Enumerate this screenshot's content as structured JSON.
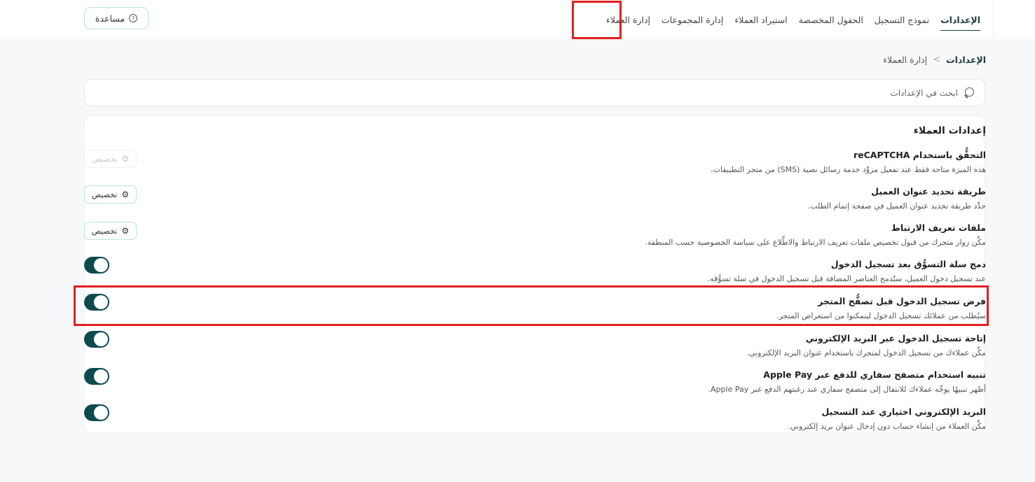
{
  "nav": {
    "items": [
      {
        "label": "إدارة العملاء",
        "active": false
      },
      {
        "label": "إدارة المجموعات",
        "active": false
      },
      {
        "label": "استيراد العملاء",
        "active": false
      },
      {
        "label": "الحقول المخصصة",
        "active": false
      },
      {
        "label": "نموذج التسجيل",
        "active": false
      },
      {
        "label": "الإعدادات",
        "active": true
      }
    ],
    "help_label": "مساعدة",
    "help_icon": "question-circle-icon"
  },
  "breadcrumb": {
    "parent": "إدارة العملاء",
    "separator": ">",
    "current": "الإعدادات"
  },
  "search": {
    "placeholder": "ابحث في الإعدادات",
    "value": ""
  },
  "section": {
    "title": "إعدادات العملاء"
  },
  "settings": [
    {
      "title": "التحقُّق باستخدام reCAPTCHA",
      "description": "هذه الميزة متاحة فقط عند تفعيل مزوِّد خدمة رسائل نصية (SMS) من متجر التطبيقات.",
      "control": "customize",
      "control_label": "تخصيص",
      "enabled": false
    },
    {
      "title": "طريقة تحديد عنوان العميل",
      "description": "حدِّد طريقة تحديد عنوان العميل في صفحة إتمام الطلب.",
      "control": "customize",
      "control_label": "تخصيص",
      "enabled": true
    },
    {
      "title": "ملفات تعريف الارتباط",
      "description": "مكِّن زوار متجرك من قبول تخصيص ملفات تعريف الارتباط والاطِّلاع على سياسة الخصوصية حسب المنطقة.",
      "control": "customize",
      "control_label": "تخصيص",
      "enabled": true
    },
    {
      "title": "دمج سلة التسوُّق بعد تسجيل الدخول",
      "description": "عند تسجيل دخول العميل، ستُدمج العناصر المضافة قبل تسجيل الدخول في سلة تسوُّقه.",
      "control": "toggle",
      "on": true
    },
    {
      "title": "فرض تسجيل الدخول قبل تصفُّح المتجر",
      "description": "سيُطلب من عملائك تسجيل الدخول ليتمكنوا من استعراض المتجر.",
      "control": "toggle",
      "on": true
    },
    {
      "title": "إتاحة تسجيل الدخول عبر البريد الإلكتروني",
      "description": "مكِّن عملاءك من تسجيل الدخول لمتجرك باستخدام عنوان البريد الإلكتروني.",
      "control": "toggle",
      "on": true
    },
    {
      "title": "تنبيه استخدام متصفح سفاري للدفع عبر Apple Pay",
      "description": "أظهر تنبيهًا يوجِّه عملاءك للانتقال إلى متصفح سفاري عند رغبتهم الدفع عبر Apple Pay.",
      "control": "toggle",
      "on": true
    },
    {
      "title": "البريد الإلكتروني اختياري عند التسجيل",
      "description": "مكِّن العملاء من إنشاء حساب دون إدخال عنوان بريد إلكتروني.",
      "control": "toggle",
      "on": true
    }
  ],
  "colors": {
    "accent": "#0d4a4f",
    "highlight": "#e02020",
    "button_border": "#b7e4de"
  }
}
